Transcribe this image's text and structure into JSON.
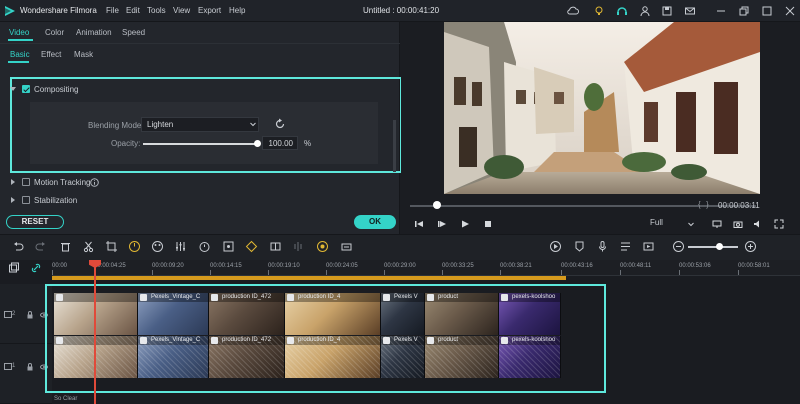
{
  "app": {
    "name": "Wondershare Filmora",
    "title": "Untitled : 00:00:41:20",
    "menu": [
      "File",
      "Edit",
      "Tools",
      "View",
      "Export",
      "Help"
    ]
  },
  "left_panel": {
    "tabs": [
      "Video",
      "Color",
      "Animation",
      "Speed"
    ],
    "active_tab": "Video",
    "subtabs": [
      "Basic",
      "Effect",
      "Mask"
    ],
    "active_subtab": "Basic",
    "compositing": {
      "label": "Compositing",
      "checked": true,
      "blending_label": "Blending Mode:",
      "blending_value": "Lighten",
      "opacity_label": "Opacity:",
      "opacity_value": "100.00",
      "opacity_unit": "%",
      "opacity_level": 1.0
    },
    "motion_tracking": "Motion Tracking",
    "stabilization": "Stabilization",
    "reset_label": "RESET",
    "ok_label": "OK"
  },
  "preview": {
    "timecode": "00:00:03:11",
    "quality": "Full",
    "progress": 0.07
  },
  "timeline": {
    "ruler_ticks": [
      "00:00",
      "00:00:04:25",
      "00:00:09:20",
      "00:00:14:15",
      "00:00:19:10",
      "00:00:24:05",
      "00:00:29:00",
      "00:00:33:25",
      "00:00:38:21",
      "00:00:43:16",
      "00:00:48:11",
      "00:00:53:06",
      "00:00:58:01"
    ],
    "tracks": [
      {
        "label": "2",
        "clips": [
          "",
          "Pexels_Vintage_C",
          "production ID_472",
          "production ID_4",
          "Pexels V",
          "product",
          "pexels-koolshoo"
        ]
      },
      {
        "label": "1",
        "clips": [
          "",
          "Pexels_Vintage_C",
          "production ID_472",
          "production ID_4",
          "Pexels V",
          "product",
          "pexels-koolshoo"
        ]
      }
    ],
    "footer_label": "So Clear"
  },
  "colors": {
    "accent": "#34d3c8",
    "highlight_box": "#5ee8dc",
    "playhead": "#e04a3a",
    "render_bar": "#d69a1d"
  }
}
